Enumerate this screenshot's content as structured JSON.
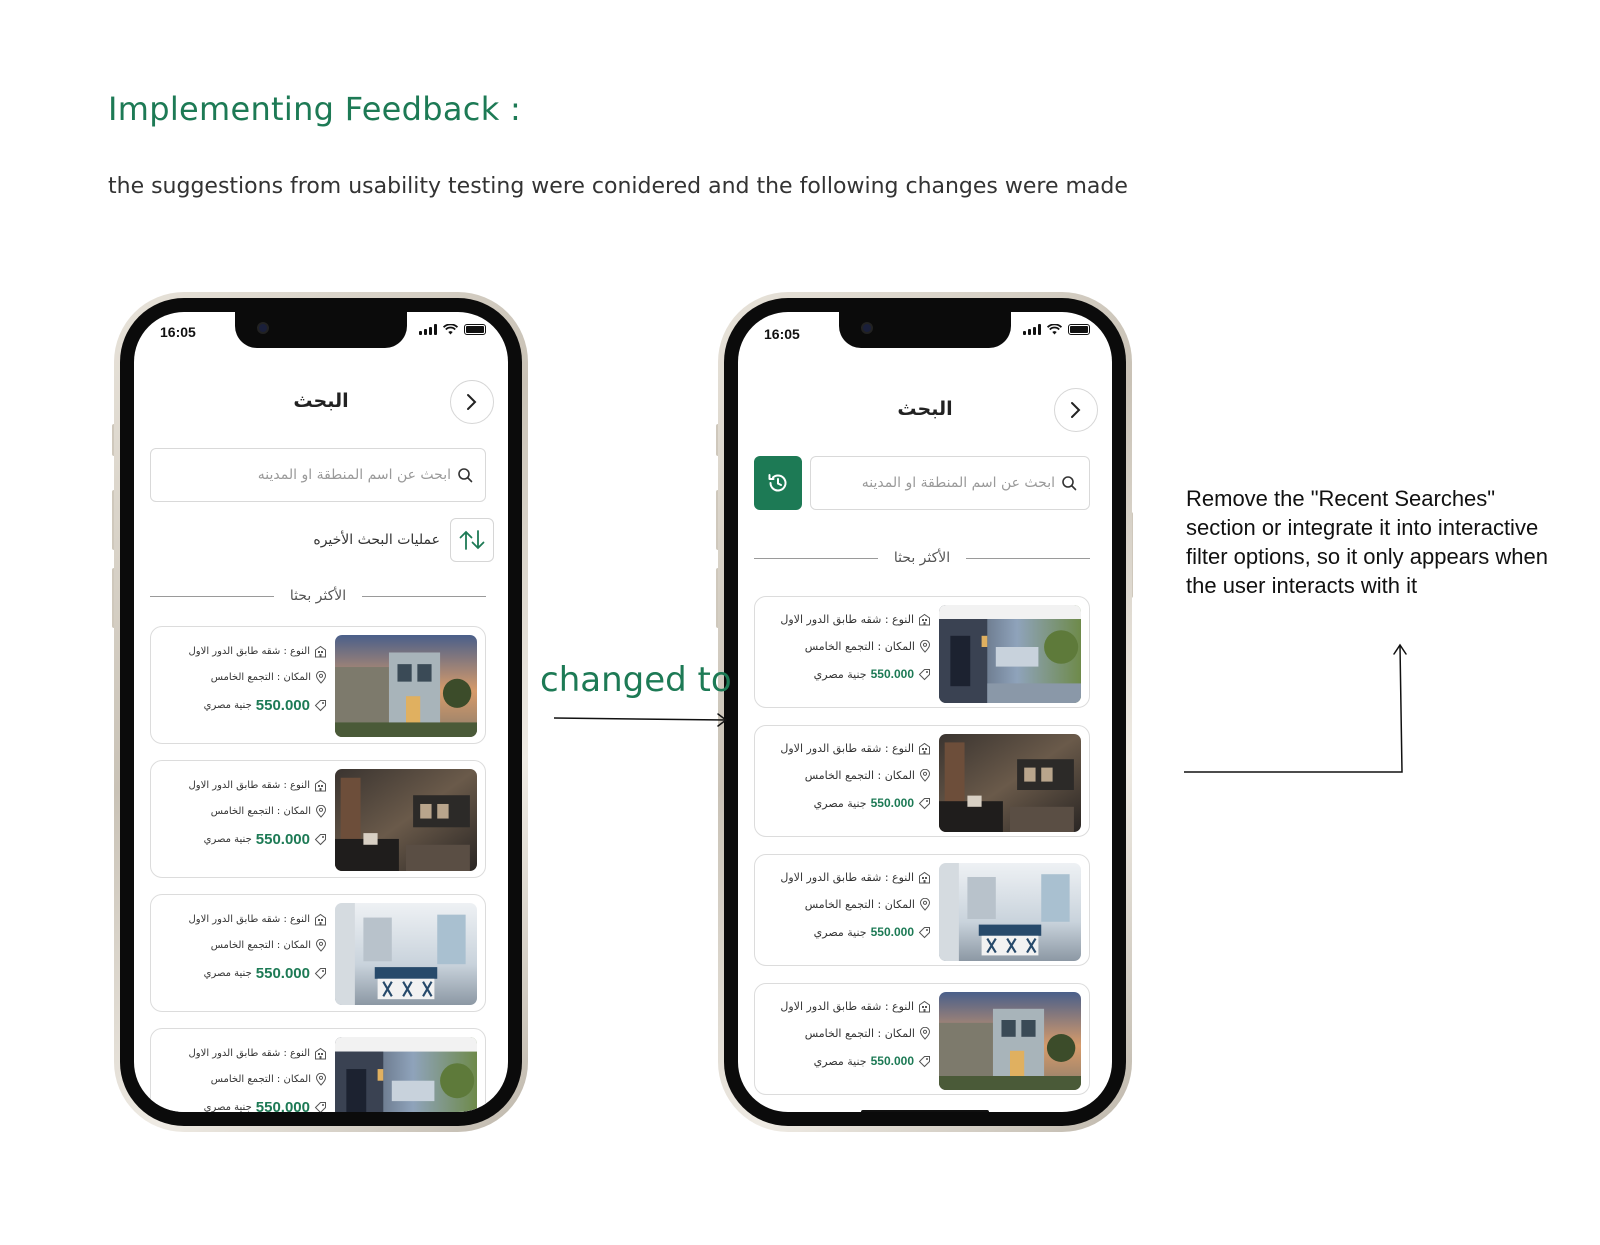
{
  "heading": "Implementing Feedback :",
  "subheading": "the suggestions from usability testing were conidered and the following changes were made",
  "connector_label": "changed to",
  "note": "Remove the \"Recent Searches\" section or integrate it into interactive filter options, so it only appears when the user interacts with it",
  "colors": {
    "accent": "#1d7a55",
    "text": "#222222"
  },
  "before": {
    "time": "16:05",
    "title": "البحث",
    "search_placeholder": "ابحث عن اسم المنطقة او المدينه",
    "recent_label": "عمليات البحث الأخيره",
    "section_label": "الأكثر بحثا",
    "cards": [
      {
        "type": "النوع : شقه طابق الدور الاول",
        "place": "المكان : التجمع الخامس",
        "price": "550.000",
        "currency": "جنية مصري",
        "image": "modern-house-exterior"
      },
      {
        "type": "النوع : شقه طابق الدور الاول",
        "place": "المكان : التجمع الخامس",
        "price": "550.000",
        "currency": "جنية مصري",
        "image": "living-room-interior"
      },
      {
        "type": "النوع : شقه طابق الدور الاول",
        "place": "المكان : التجمع الخامس",
        "price": "550.000",
        "currency": "جنية مصري",
        "image": "kitchen-interior"
      },
      {
        "type": "النوع : شقه طابق الدور الاول",
        "place": "المكان : التجمع الخامس",
        "price": "550.000",
        "currency": "جنية مصري",
        "image": "porch-exterior"
      }
    ]
  },
  "after": {
    "time": "16:05",
    "title": "البحث",
    "search_placeholder": "ابحث عن اسم المنطقة او المدينه",
    "section_label": "الأكثر بحثا",
    "cards": [
      {
        "type": "النوع : شقه طابق الدور الاول",
        "place": "المكان : التجمع الخامس",
        "price": "550.000",
        "currency": "جنية مصري",
        "image": "porch-exterior"
      },
      {
        "type": "النوع : شقه طابق الدور الاول",
        "place": "المكان : التجمع الخامس",
        "price": "550.000",
        "currency": "جنية مصري",
        "image": "living-room-interior"
      },
      {
        "type": "النوع : شقه طابق الدور الاول",
        "place": "المكان : التجمع الخامس",
        "price": "550.000",
        "currency": "جنية مصري",
        "image": "kitchen-interior"
      },
      {
        "type": "النوع : شقه طابق الدور الاول",
        "place": "المكان : التجمع الخامس",
        "price": "550.000",
        "currency": "جنية مصري",
        "image": "modern-house-exterior"
      }
    ]
  }
}
